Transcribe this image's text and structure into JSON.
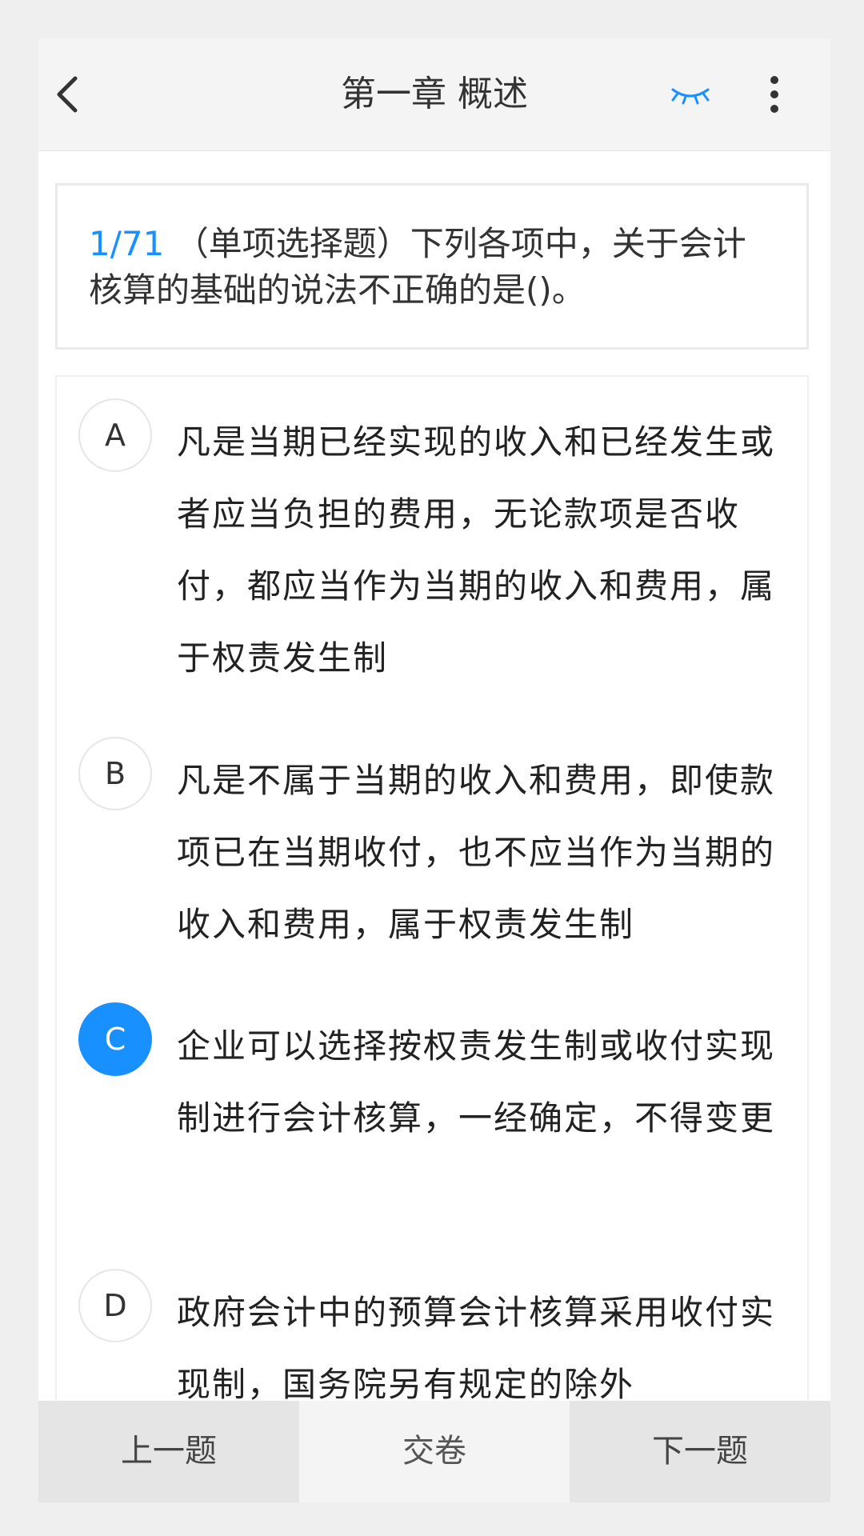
{
  "header": {
    "title": "第一章 概述",
    "back_icon": "chevron-left-icon",
    "eye_icon": "eye-closed-icon",
    "more_icon": "more-vertical-icon",
    "accent_color": "#1890ff"
  },
  "question": {
    "index": "1/71",
    "text": "（单项选择题）下列各项中，关于会计核算的基础的说法不正确的是()。"
  },
  "options": [
    {
      "letter": "A",
      "text": "凡是当期已经实现的收入和已经发生或者应当负担的费用，无论款项是否收付，都应当作为当期的收入和费用，属于权责发生制",
      "selected": false
    },
    {
      "letter": "B",
      "text": "凡是不属于当期的收入和费用，即使款项已在当期收付，也不应当作为当期的收入和费用，属于权责发生制",
      "selected": false
    },
    {
      "letter": "C",
      "text": "企业可以选择按权责发生制或收付实现制进行会计核算，一经确定，不得变更",
      "selected": true
    },
    {
      "letter": "D",
      "text": "政府会计中的预算会计核算采用收付实现制，国务院另有规定的除外",
      "selected": false
    }
  ],
  "footer": {
    "prev_label": "上一题",
    "submit_label": "交卷",
    "next_label": "下一题"
  }
}
